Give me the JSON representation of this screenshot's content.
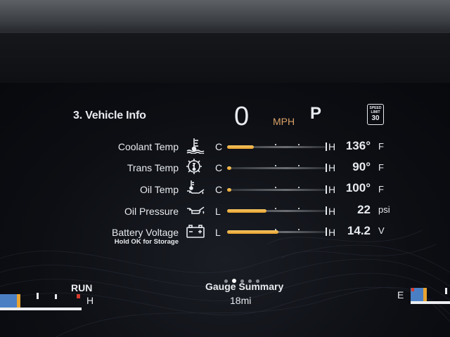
{
  "header": {
    "page_title": "3. Vehicle Info",
    "speed": "0",
    "speed_unit": "MPH",
    "gear": "P",
    "speed_limit": {
      "label": "SPEED LIMIT",
      "value": "30"
    }
  },
  "gauges": [
    {
      "label": "Coolant Temp",
      "icon": "coolant-temperature-icon",
      "low": "C",
      "high": "H",
      "value": "136°",
      "unit": "F",
      "level": 0.27
    },
    {
      "label": "Trans Temp",
      "icon": "transmission-temperature-icon",
      "low": "C",
      "high": "H",
      "value": "90°",
      "unit": "F",
      "level": 0.04
    },
    {
      "label": "Oil Temp",
      "icon": "oil-temperature-icon",
      "low": "C",
      "high": "H",
      "value": "100°",
      "unit": "F",
      "level": 0.03
    },
    {
      "label": "Oil Pressure",
      "icon": "oil-pressure-icon",
      "low": "L",
      "high": "H",
      "value": "22",
      "unit": "psi",
      "level": 0.4
    },
    {
      "label": "Battery Voltage",
      "icon": "battery-icon",
      "low": "L",
      "high": "H",
      "value": "14.2",
      "unit": "V",
      "level": 0.52
    }
  ],
  "battery_hint": "Hold OK for Storage",
  "footer": {
    "page_count": 5,
    "active_page": 2,
    "summary_label": "Gauge Summary",
    "trip": "18mi",
    "run_label": "RUN",
    "left_gauge_end": "H",
    "right_gauge_end": "E"
  },
  "colors": {
    "gauge_fill": "#e8a330",
    "accent_text": "#d9a066",
    "strip_blue": "#4b7fc4"
  }
}
